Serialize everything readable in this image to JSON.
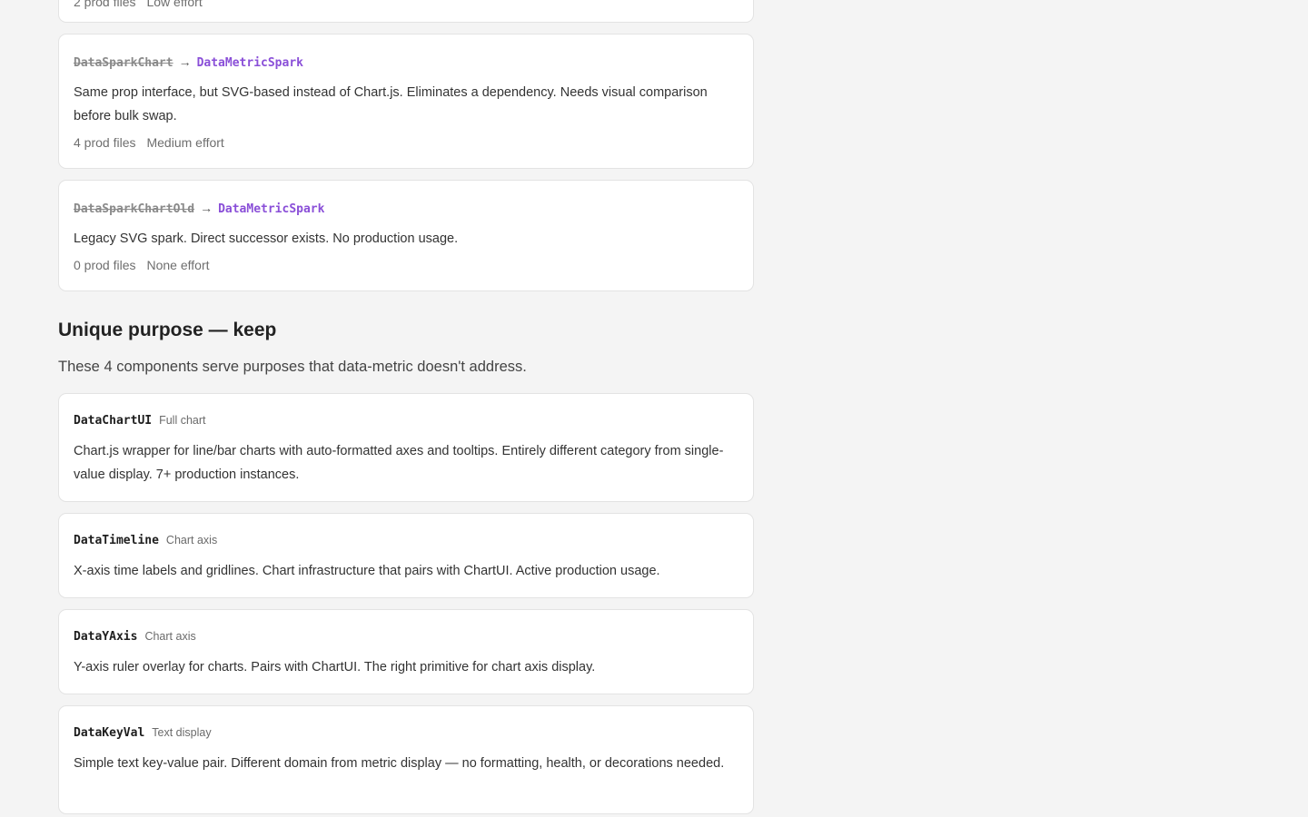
{
  "top_card": {
    "meta_files": "2 prod files",
    "meta_effort": "Low effort"
  },
  "migrations": [
    {
      "old": "DataSparkChart",
      "arrow": "→",
      "new": "DataMetricSpark",
      "description": "Same prop interface, but SVG-based instead of Chart.js. Eliminates a dependency. Needs visual comparison before bulk swap.",
      "files": "4 prod files",
      "effort": "Medium effort"
    },
    {
      "old": "DataSparkChartOld",
      "arrow": "→",
      "new": "DataMetricSpark",
      "description": "Legacy SVG spark. Direct successor exists. No production usage.",
      "files": "0 prod files",
      "effort": "None effort"
    }
  ],
  "unique_section": {
    "title": "Unique purpose — keep",
    "description": "These 4 components serve purposes that data-metric doesn't address."
  },
  "unique": [
    {
      "name": "DataChartUI",
      "tag": "Full chart",
      "description": "Chart.js wrapper for line/bar charts with auto-formatted axes and tooltips. Entirely different category from single-value display. 7+ production instances."
    },
    {
      "name": "DataTimeline",
      "tag": "Chart axis",
      "description": "X-axis time labels and gridlines. Chart infrastructure that pairs with ChartUI. Active production usage."
    },
    {
      "name": "DataYAxis",
      "tag": "Chart axis",
      "description": "Y-axis ruler overlay for charts. Pairs with ChartUI. The right primitive for chart axis display."
    },
    {
      "name": "DataKeyVal",
      "tag": "Text display",
      "description": "Simple text key-value pair. Different domain from metric display — no formatting, health, or decorations needed."
    }
  ],
  "colors": {
    "new_name": "#8a4fd8",
    "background": "#f4f4f4",
    "card": "#ffffff"
  }
}
